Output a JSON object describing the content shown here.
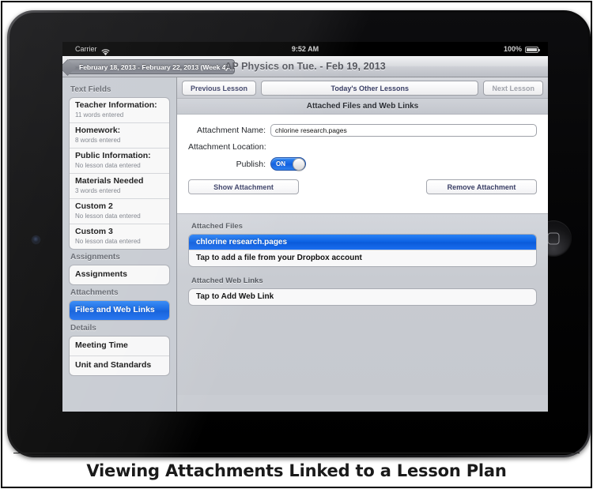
{
  "caption": "Viewing Attachments Linked to a Lesson Plan",
  "device": {
    "home_button": "home-button",
    "camera": "front-camera"
  },
  "status_bar": {
    "carrier": "Carrier",
    "wifi_icon": "wifi-icon",
    "time": "9:52 AM",
    "battery_percent": "100%",
    "battery_icon": "battery-full-icon"
  },
  "nav_bar": {
    "back_label": "February 18, 2013 - February 22, 2013 (Week 4)",
    "title": "AP Physics on Tue. - Feb 19, 2013"
  },
  "sidebar": {
    "groups": [
      {
        "title": "Text Fields",
        "items": [
          {
            "label": "Teacher Information:",
            "sub": "11 words entered",
            "selected": false
          },
          {
            "label": "Homework:",
            "sub": "8 words entered",
            "selected": false
          },
          {
            "label": "Public Information:",
            "sub": "No lesson data entered",
            "selected": false
          },
          {
            "label": "Materials Needed",
            "sub": "3 words entered",
            "selected": false
          },
          {
            "label": "Custom 2",
            "sub": "No lesson data entered",
            "selected": false
          },
          {
            "label": "Custom 3",
            "sub": "No lesson data entered",
            "selected": false
          }
        ]
      },
      {
        "title": "Assignments",
        "items": [
          {
            "label": "Assignments",
            "sub": "",
            "selected": false
          }
        ]
      },
      {
        "title": "Attachments",
        "items": [
          {
            "label": "Files and Web Links",
            "sub": "",
            "selected": true
          }
        ]
      },
      {
        "title": "Details",
        "items": [
          {
            "label": "Meeting Time",
            "sub": "",
            "selected": false
          },
          {
            "label": "Unit and Standards",
            "sub": "",
            "selected": false
          }
        ]
      }
    ]
  },
  "toolbar": {
    "previous_lesson": "Previous Lesson",
    "todays_other_lessons": "Today's Other Lessons",
    "next_lesson": "Next Lesson"
  },
  "content": {
    "section_header": "Attached Files and Web Links",
    "attachment_name_label": "Attachment Name:",
    "attachment_name_value": "chlorine research.pages",
    "attachment_name_placeholder": "Attachment Name",
    "attachment_location_label": "Attachment Location:",
    "attachment_location_value": "",
    "publish_label": "Publish:",
    "publish_state": "ON",
    "show_attachment_button": "Show Attachment",
    "remove_attachment_button": "Remove Attachment"
  },
  "lists": {
    "attached_files_title": "Attached Files",
    "attached_files": [
      {
        "label": "chlorine research.pages",
        "selected": true
      },
      {
        "label": "Tap to add a file from your Dropbox account",
        "selected": false
      }
    ],
    "attached_web_links_title": "Attached Web Links",
    "attached_web_links": [
      {
        "label": "Tap to Add Web Link",
        "selected": false
      }
    ]
  },
  "colors": {
    "accent_blue": "#0b60e2",
    "bezel_black": "#0a0a0b",
    "panel_gray": "#c6cad1"
  }
}
